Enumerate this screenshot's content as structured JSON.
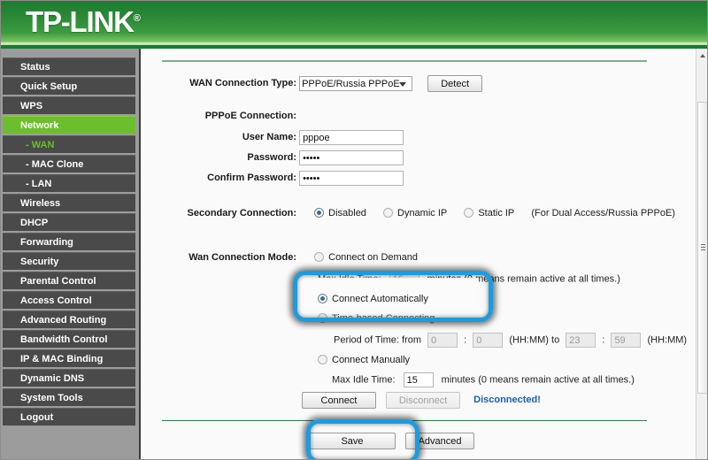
{
  "header": {
    "brand": "TP-LINK",
    "registered_mark": "®"
  },
  "sidebar": {
    "items": [
      {
        "label": "Status",
        "type": "top",
        "state": "normal"
      },
      {
        "label": "Quick Setup",
        "type": "top",
        "state": "normal"
      },
      {
        "label": "WPS",
        "type": "top",
        "state": "normal"
      },
      {
        "label": "Network",
        "type": "top",
        "state": "active"
      },
      {
        "label": "- WAN",
        "type": "sub",
        "state": "selected"
      },
      {
        "label": "- MAC Clone",
        "type": "sub",
        "state": "normal"
      },
      {
        "label": "- LAN",
        "type": "sub",
        "state": "normal"
      },
      {
        "label": "Wireless",
        "type": "top",
        "state": "normal"
      },
      {
        "label": "DHCP",
        "type": "top",
        "state": "normal"
      },
      {
        "label": "Forwarding",
        "type": "top",
        "state": "normal"
      },
      {
        "label": "Security",
        "type": "top",
        "state": "normal"
      },
      {
        "label": "Parental Control",
        "type": "top",
        "state": "normal"
      },
      {
        "label": "Access Control",
        "type": "top",
        "state": "normal"
      },
      {
        "label": "Advanced Routing",
        "type": "top",
        "state": "normal"
      },
      {
        "label": "Bandwidth Control",
        "type": "top",
        "state": "normal"
      },
      {
        "label": "IP & MAC Binding",
        "type": "top",
        "state": "normal"
      },
      {
        "label": "Dynamic DNS",
        "type": "top",
        "state": "normal"
      },
      {
        "label": "System Tools",
        "type": "top",
        "state": "normal"
      },
      {
        "label": "Logout",
        "type": "top",
        "state": "normal"
      }
    ]
  },
  "form": {
    "wan_type_label": "WAN Connection Type:",
    "wan_type_value": "PPPoE/Russia PPPoE",
    "detect_button": "Detect",
    "pppoe_section_label": "PPPoE Connection:",
    "username_label": "User Name:",
    "username_value": "pppoe",
    "password_label": "Password:",
    "password_value": "•••••",
    "confirm_password_label": "Confirm Password:",
    "confirm_password_value": "•••••",
    "secondary_label": "Secondary Connection:",
    "secondary_options": [
      {
        "label": "Disabled",
        "selected": true
      },
      {
        "label": "Dynamic IP",
        "selected": false
      },
      {
        "label": "Static IP",
        "selected": false
      }
    ],
    "secondary_note": "(For Dual Access/Russia PPPoE)",
    "mode_label": "Wan Connection Mode:",
    "mode_on_demand": "Connect on Demand",
    "mode_on_demand_idle_label": "Max Idle Time:",
    "mode_on_demand_idle_value": "15",
    "mode_on_demand_idle_suffix": "minutes (0 means remain active at all times.)",
    "mode_automatically": "Connect Automatically",
    "mode_time_based": "Time-based Connecting",
    "period_label": "Period of Time: from",
    "period_from_hh": "0",
    "period_from_mm": "0",
    "period_sep_note": "(HH:MM) to",
    "period_to_hh": "23",
    "period_to_mm": "59",
    "period_end_note": "(HH:MM)",
    "colon": ":",
    "mode_manually": "Connect Manually",
    "manual_idle_label": "Max Idle Time:",
    "manual_idle_value": "15",
    "manual_idle_suffix": "minutes (0 means remain active at all times.)",
    "connect_button": "Connect",
    "disconnect_button": "Disconnect",
    "connection_status": "Disconnected!",
    "save_button": "Save",
    "advanced_button": "Advanced"
  },
  "annotations": {
    "highlight_1_target": "Connect Automatically",
    "highlight_2_target": "Save",
    "highlight_color": "#1b9ce0"
  },
  "colors": {
    "header_green_dark": "#1e7a31",
    "header_green_light": "#79c460",
    "menu_active_green": "#6cbf2c",
    "status_blue": "#1b5fae"
  }
}
